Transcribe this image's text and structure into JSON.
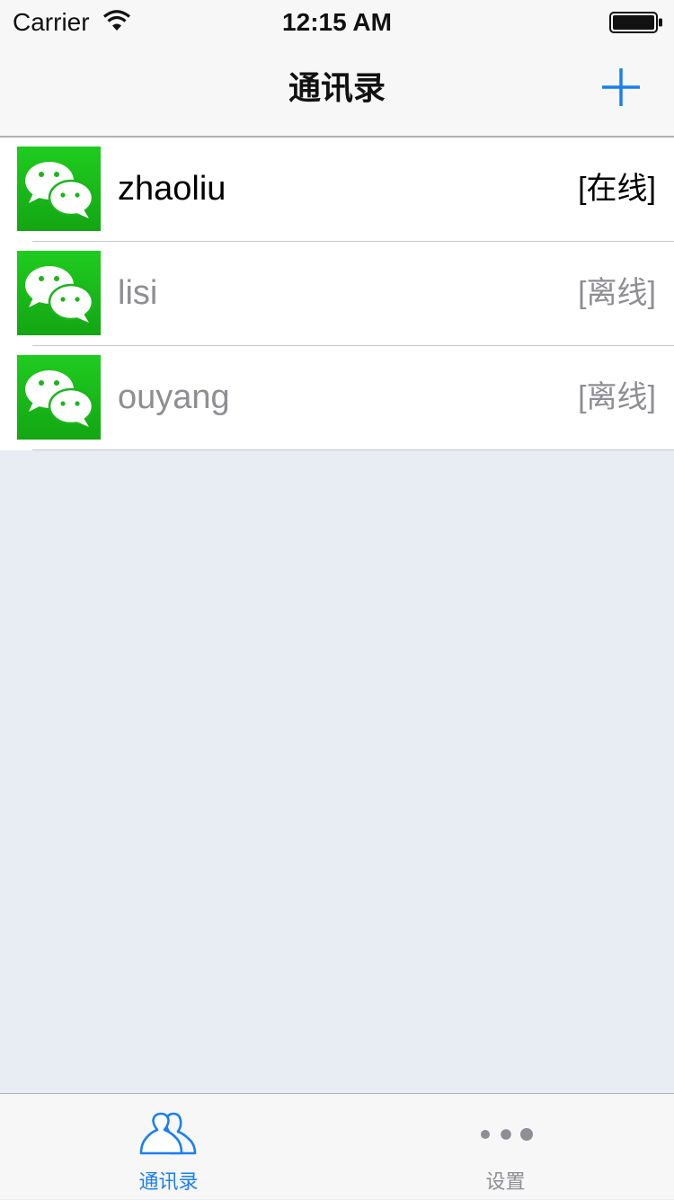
{
  "status_bar": {
    "carrier": "Carrier",
    "time": "12:15 AM",
    "wifi_icon": "wifi-icon",
    "battery_icon": "battery-icon"
  },
  "nav": {
    "title": "通讯录",
    "add_icon": "plus-icon",
    "accent_color": "#1a7ff0"
  },
  "contacts": [
    {
      "name": "zhaoliu",
      "status": "[在线]",
      "online": true
    },
    {
      "name": "lisi",
      "status": "[离线]",
      "online": false
    },
    {
      "name": "ouyang",
      "status": "[离线]",
      "online": false
    }
  ],
  "avatar_icon": "wechat-logo-icon",
  "avatar_color": "#1bb51b",
  "tab_bar": {
    "tabs": [
      {
        "label": "通讯录",
        "icon": "contacts-icon",
        "selected": true
      },
      {
        "label": "设置",
        "icon": "more-dots-icon",
        "selected": false
      }
    ]
  }
}
